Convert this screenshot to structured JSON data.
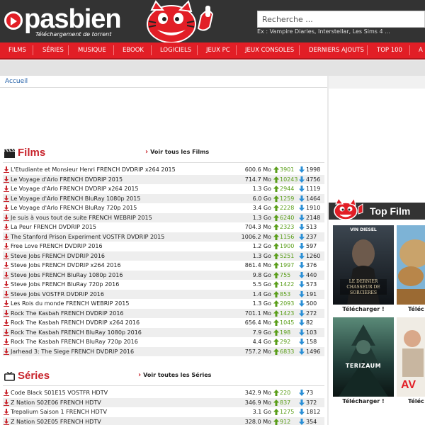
{
  "header": {
    "logo_text": "pasbien",
    "logo_sub": "Téléchargement de torrent",
    "search_placeholder": "Recherche ...",
    "search_hint": "Ex : Vampire Diaries, Interstellar, Les Sims 4 ..."
  },
  "nav": {
    "items": [
      "Films",
      "Séries",
      "Musique",
      "Ebook",
      "Logiciels",
      "Jeux PC",
      "Jeux Consoles",
      "Derniers ajouts",
      "Top 100",
      "A"
    ]
  },
  "breadcrumb": "Accueil",
  "films": {
    "title": "Films",
    "see_all": "Voir tous les Films",
    "rows": [
      {
        "name": "L'Etudiante et Monsieur Henri FRENCH DVDRIP x264 2015",
        "size": "600.6 Mo",
        "seeds": "3901",
        "leech": "1998"
      },
      {
        "name": "Le Voyage d'Arlo FRENCH DVDRIP 2015",
        "size": "714.7 Mo",
        "seeds": "10243",
        "leech": "4756"
      },
      {
        "name": "Le Voyage d'Arlo FRENCH DVDRIP x264 2015",
        "size": "1.3 Go",
        "seeds": "2944",
        "leech": "1119"
      },
      {
        "name": "Le Voyage d'Arlo FRENCH BluRay 1080p 2015",
        "size": "6.0 Go",
        "seeds": "1259",
        "leech": "1464"
      },
      {
        "name": "Le Voyage d'Arlo FRENCH BluRay 720p 2015",
        "size": "3.4 Go",
        "seeds": "2228",
        "leech": "1910"
      },
      {
        "name": "Je suis à vous tout de suite FRENCH WEBRIP 2015",
        "size": "1.3 Go",
        "seeds": "6240",
        "leech": "2148"
      },
      {
        "name": "La Peur FRENCH DVDRIP 2015",
        "size": "704.3 Mo",
        "seeds": "2323",
        "leech": "513"
      },
      {
        "name": "The Stanford Prison Experiment VOSTFR DVDRIP 2015",
        "size": "1006.2 Mo",
        "seeds": "1156",
        "leech": "237"
      },
      {
        "name": "Free Love FRENCH DVDRIP 2016",
        "size": "1.2 Go",
        "seeds": "1900",
        "leech": "597"
      },
      {
        "name": "Steve Jobs FRENCH DVDRIP 2016",
        "size": "1.3 Go",
        "seeds": "5251",
        "leech": "1260"
      },
      {
        "name": "Steve Jobs FRENCH DVDRIP x264 2016",
        "size": "861.4 Mo",
        "seeds": "1997",
        "leech": "376"
      },
      {
        "name": "Steve Jobs FRENCH BluRay 1080p 2016",
        "size": "9.8 Go",
        "seeds": "755",
        "leech": "440"
      },
      {
        "name": "Steve Jobs FRENCH BluRay 720p 2016",
        "size": "5.5 Go",
        "seeds": "1422",
        "leech": "573"
      },
      {
        "name": "Steve Jobs VOSTFR DVDRIP 2016",
        "size": "1.4 Go",
        "seeds": "853",
        "leech": "191"
      },
      {
        "name": "Les Rois du monde FRENCH WEBRIP 2015",
        "size": "1.3 Go",
        "seeds": "2093",
        "leech": "500"
      },
      {
        "name": "Rock The Kasbah FRENCH DVDRIP 2016",
        "size": "701.1 Mo",
        "seeds": "1423",
        "leech": "272"
      },
      {
        "name": "Rock The Kasbah FRENCH DVDRIP x264 2016",
        "size": "656.4 Mo",
        "seeds": "1045",
        "leech": "82"
      },
      {
        "name": "Rock The Kasbah FRENCH BluRay 1080p 2016",
        "size": "7.9 Go",
        "seeds": "198",
        "leech": "103"
      },
      {
        "name": "Rock The Kasbah FRENCH BluRay 720p 2016",
        "size": "4.4 Go",
        "seeds": "292",
        "leech": "158"
      },
      {
        "name": "Jarhead 3: The Siege FRENCH DVDRIP 2016",
        "size": "757.2 Mo",
        "seeds": "6833",
        "leech": "1496"
      }
    ]
  },
  "series": {
    "title": "Séries",
    "see_all": "Voir toutes les Séries",
    "rows": [
      {
        "name": "Code Black S01E15 VOSTFR HDTV",
        "size": "342.9 Mo",
        "seeds": "220",
        "leech": "73"
      },
      {
        "name": "Z Nation S02E06 FRENCH HDTV",
        "size": "346.9 Mo",
        "seeds": "837",
        "leech": "372"
      },
      {
        "name": "Trepalium Saison 1 FRENCH HDTV",
        "size": "3.1 Go",
        "seeds": "1275",
        "leech": "1812"
      },
      {
        "name": "Z Nation S02E05 FRENCH HDTV",
        "size": "328.0 Mo",
        "seeds": "912",
        "leech": "354"
      }
    ]
  },
  "sidebar": {
    "top_title": "Top Film",
    "posters": [
      {
        "caption": "Télécharger !",
        "top_text": "VIN DIESEL",
        "title_text": "LE DERNIER CHASSEUR DE SORCIÈRES"
      },
      {
        "caption": "Téléc",
        "top_text": "",
        "title_text": ""
      },
      {
        "caption": "Télécharger !",
        "top_text": "",
        "title_text": "TERIZAUM"
      },
      {
        "caption": "Téléc",
        "top_text": "",
        "title_text": ""
      }
    ]
  },
  "colors": {
    "brand_red": "#e21e26",
    "header_dark": "#333333",
    "seed_green": "#5a9e1a",
    "leech_blue": "#2a8fd6",
    "link_blue": "#2461a8"
  }
}
